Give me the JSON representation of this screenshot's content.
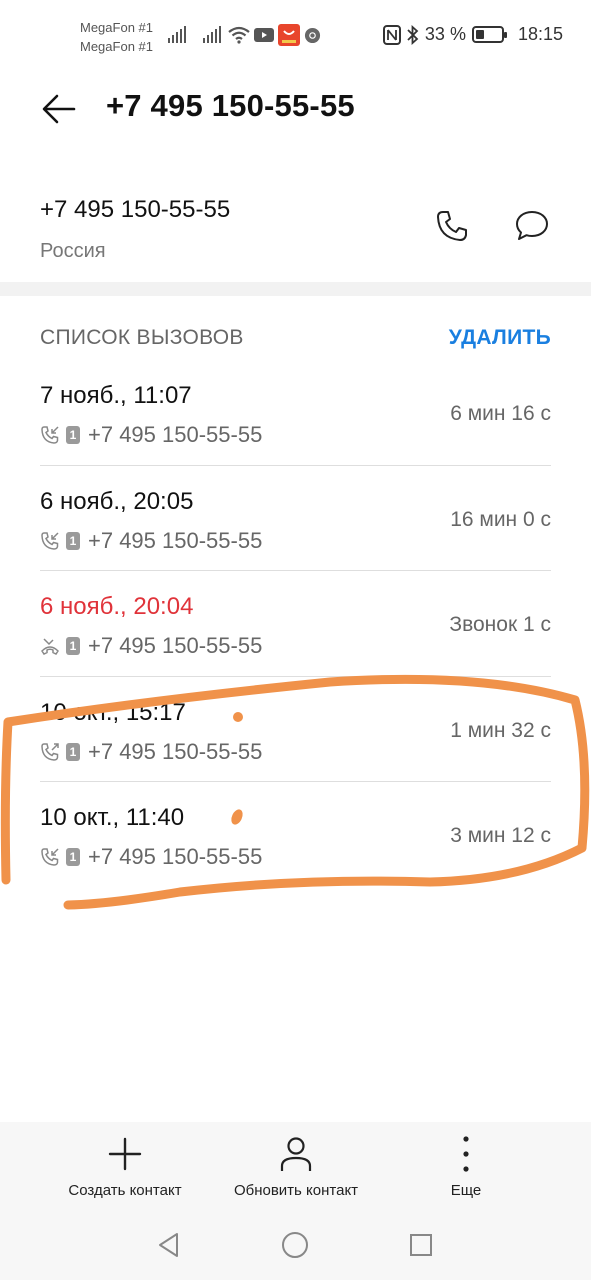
{
  "status_bar": {
    "carrier1": "MegaFon #1",
    "carrier2": "MegaFon #1",
    "battery_text": "33 %",
    "battery_level": 0.33,
    "time": "18:15",
    "icons": [
      "signal-icon",
      "signal-icon",
      "wifi-icon",
      "youtube-icon",
      "aliexpress-icon",
      "chrome-icon",
      "nfc-icon",
      "bluetooth-icon",
      "battery-icon"
    ]
  },
  "header": {
    "title": "+7 495 150-55-55",
    "back_icon": "arrow-left-icon"
  },
  "contact": {
    "number": "+7 495 150-55-55",
    "country": "Россия",
    "call_icon": "phone-icon",
    "message_icon": "message-icon"
  },
  "calls_section": {
    "title": "СПИСОК ВЫЗОВОВ",
    "delete_label": "УДАЛИТЬ",
    "accent_color": "#1a7fe0",
    "missed_color": "#e0333a",
    "calls": [
      {
        "date": "7 нояб., 11:07",
        "number": "+7 495 150-55-55",
        "sim": "1",
        "duration": "6 мин 16 с",
        "type": "incoming",
        "missed": false
      },
      {
        "date": "6 нояб., 20:05",
        "number": "+7 495 150-55-55",
        "sim": "1",
        "duration": "16 мин 0 с",
        "type": "incoming",
        "missed": false
      },
      {
        "date": "6 нояб., 20:04",
        "number": "+7 495 150-55-55",
        "sim": "1",
        "duration": "Звонок 1 с",
        "type": "missed",
        "missed": true
      },
      {
        "date": "10 окт., 15:17",
        "number": "+7 495 150-55-55",
        "sim": "1",
        "duration": "1 мин 32 с",
        "type": "outgoing",
        "missed": false
      },
      {
        "date": "10 окт., 11:40",
        "number": "+7 495 150-55-55",
        "sim": "1",
        "duration": "3 мин 12 с",
        "type": "incoming",
        "missed": false
      }
    ]
  },
  "annotation": {
    "color": "#f0924a"
  },
  "bottom_bar": {
    "create_label": "Создать контакт",
    "update_label": "Обновить контакт",
    "more_label": "Еще"
  },
  "nav_bar": {
    "icons": [
      "back-triangle-icon",
      "home-circle-icon",
      "recents-square-icon"
    ]
  }
}
